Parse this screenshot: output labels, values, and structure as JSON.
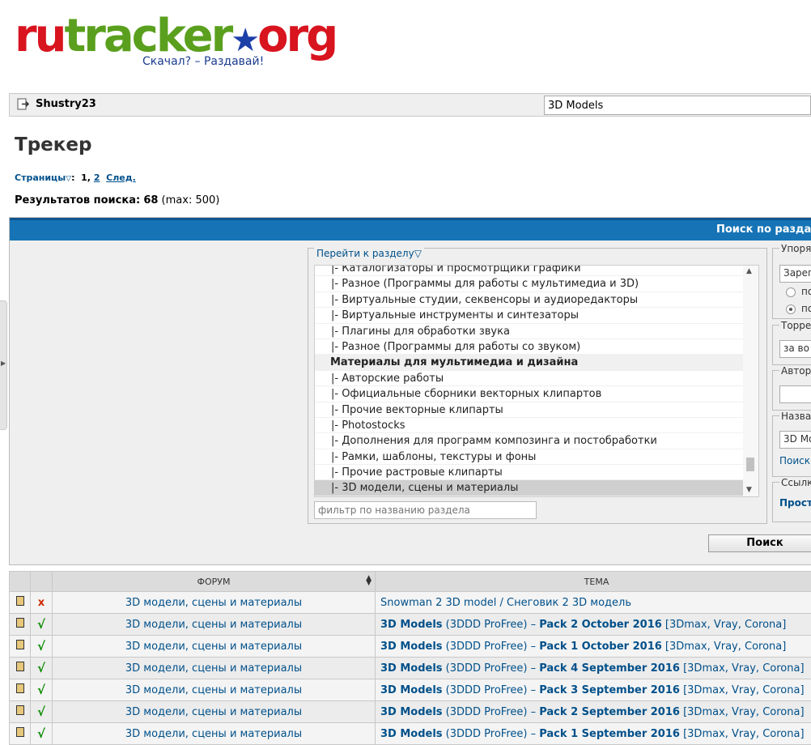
{
  "logo": {
    "ru": "ru",
    "tracker": "tracker",
    "org": "org",
    "slogan": "Скачал? – Раздавай!"
  },
  "userbar": {
    "username": "Shustry23",
    "search_value": "3D Models"
  },
  "page_title": "Трекер",
  "pager": {
    "label": "Страницы",
    "current": "1",
    "page2": "2",
    "next": "След."
  },
  "results": {
    "label": "Результатов поиска:",
    "count": "68",
    "max": "(max: 500)"
  },
  "panel": {
    "title": "Поиск по раздача",
    "forum_legend": "Перейти к разделу",
    "forum_options": [
      {
        "label": "|- Каталогизаторы и просмотрщики графики",
        "type": "item"
      },
      {
        "label": "|- Разное (Программы для работы с мультимедиа и 3D)",
        "type": "item"
      },
      {
        "label": "|- Виртуальные студии, секвенсоры и аудиоредакторы",
        "type": "item"
      },
      {
        "label": "|- Виртуальные инструменты и синтезаторы",
        "type": "item"
      },
      {
        "label": "|- Плагины для обработки звука",
        "type": "item"
      },
      {
        "label": "|- Разное (Программы для работы со звуком)",
        "type": "item"
      },
      {
        "label": "Материалы для мультимедиа и дизайна",
        "type": "group"
      },
      {
        "label": "|- Авторские работы",
        "type": "item"
      },
      {
        "label": "|- Официальные сборники векторных клипартов",
        "type": "item"
      },
      {
        "label": "|- Прочие векторные клипарты",
        "type": "item"
      },
      {
        "label": "|- Photostocks",
        "type": "item"
      },
      {
        "label": "|- Дополнения для программ композинга и постобработки",
        "type": "item"
      },
      {
        "label": "|- Рамки, шаблоны, текстуры и фоны",
        "type": "item"
      },
      {
        "label": "|- Прочие растровые клипарты",
        "type": "item"
      },
      {
        "label": "|- 3D модели, сцены и материалы",
        "type": "selected"
      }
    ],
    "filter_placeholder": "фильтр по названию раздела",
    "sort_legend": "Упоря",
    "sort_value": "Зарег",
    "radio1": "по",
    "radio2": "по",
    "torrents_legend": "Торре",
    "torrents_value": "за во",
    "author_legend": "Автор",
    "author_value": "",
    "title_legend": "Назва",
    "title_value": "3D Mo",
    "title_link": "Поиск",
    "link_legend": "Ссылк",
    "link_value": "Прост",
    "search_button": "Поиск"
  },
  "table": {
    "col_forum": "ФОРУМ",
    "col_topic": "ТЕМА",
    "rows": [
      {
        "status": "x",
        "forum": "3D модели, сцены и материалы",
        "t1": "Snowman 2 3D model / Снеговик 2 3D модель",
        "t2": "",
        "t3": "",
        "t4": "",
        "plain": true
      },
      {
        "status": "√",
        "forum": "3D модели, сцены и материалы",
        "t1": "3D Models",
        "t2": " (3DDD ProFree) – ",
        "t3": "Pack 2 October 2016",
        "t4": " [3Dmax, Vray, Corona]"
      },
      {
        "status": "√",
        "forum": "3D модели, сцены и материалы",
        "t1": "3D Models",
        "t2": " (3DDD ProFree) – ",
        "t3": "Pack 1 October 2016",
        "t4": " [3Dmax, Vray, Corona]"
      },
      {
        "status": "√",
        "forum": "3D модели, сцены и материалы",
        "t1": "3D Models",
        "t2": " (3DDD ProFree) – ",
        "t3": "Pack 4 September 2016",
        "t4": " [3Dmax, Vray, Corona]"
      },
      {
        "status": "√",
        "forum": "3D модели, сцены и материалы",
        "t1": "3D Models",
        "t2": " (3DDD ProFree) – ",
        "t3": "Pack 3 September 2016",
        "t4": " [3Dmax, Vray, Corona]"
      },
      {
        "status": "√",
        "forum": "3D модели, сцены и материалы",
        "t1": "3D Models",
        "t2": " (3DDD ProFree) – ",
        "t3": "Pack 2 September 2016",
        "t4": " [3Dmax, Vray, Corona]"
      },
      {
        "status": "√",
        "forum": "3D модели, сцены и материалы",
        "t1": "3D Models",
        "t2": " (3DDD ProFree) – ",
        "t3": "Pack 1 September 2016",
        "t4": " [3Dmax, Vray, Corona]"
      }
    ]
  },
  "colors": {
    "header_blue": "#1674b6",
    "link": "#00508a",
    "ok": "#0a8a00",
    "bad": "#d02a00"
  }
}
